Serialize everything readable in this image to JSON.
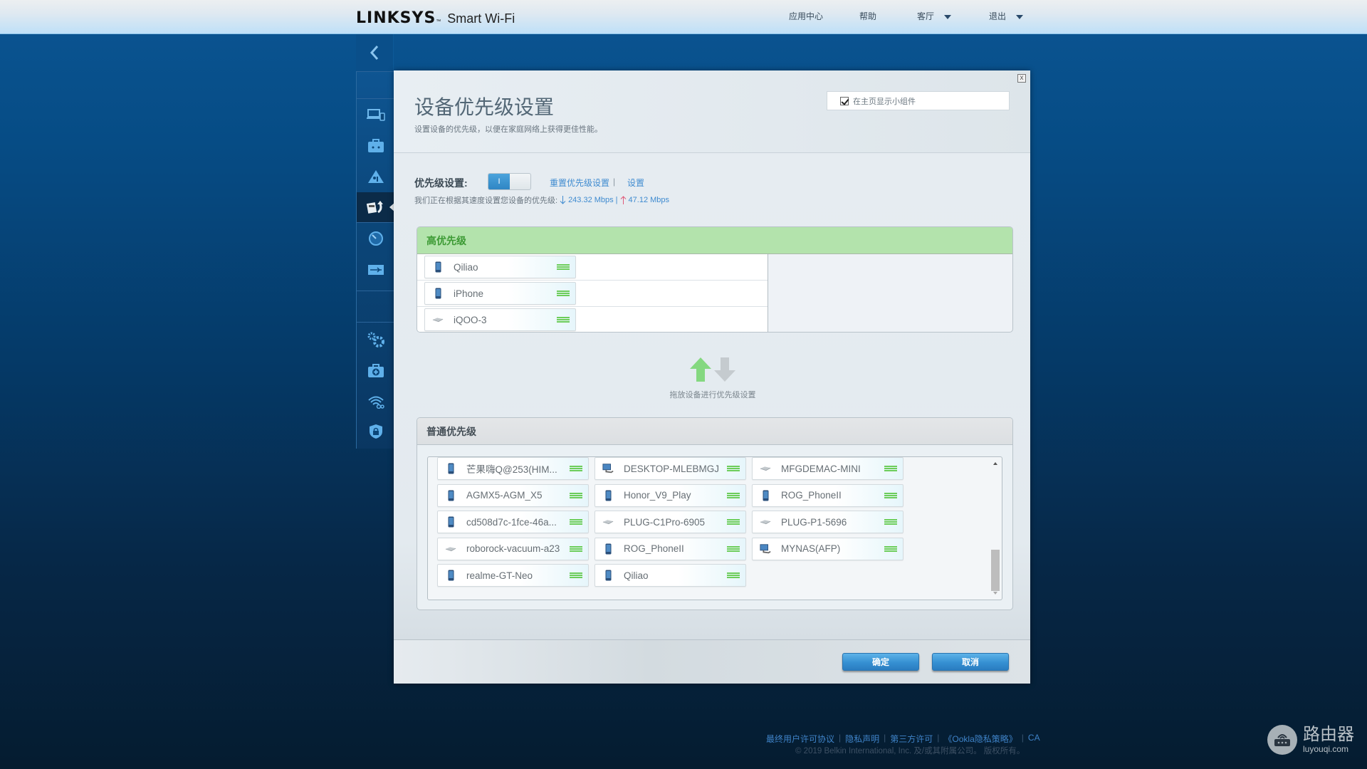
{
  "header": {
    "brand": "LINKSYS",
    "brand_tm": "™",
    "product": "Smart Wi-Fi",
    "nav": [
      {
        "label": "应用中心"
      },
      {
        "label": "帮助"
      },
      {
        "label": "客厅",
        "has_dropdown": true
      },
      {
        "label": "退出",
        "has_dropdown": true
      }
    ]
  },
  "sidebar": {
    "back_icon": "chevron-left-icon",
    "items": [
      {
        "icon": "devices-icon",
        "name": "设备列表"
      },
      {
        "icon": "guest-access-icon",
        "name": "访客访问"
      },
      {
        "icon": "parental-controls-icon",
        "name": "家长控制"
      },
      {
        "icon": "media-prioritization-icon",
        "name": "设备优先级",
        "active": true
      },
      {
        "icon": "speed-test-icon",
        "name": "速度测试"
      },
      {
        "icon": "external-storage-icon",
        "name": "外部存储"
      },
      {
        "icon": "connectivity-icon",
        "name": "连接"
      },
      {
        "icon": "troubleshooting-icon",
        "name": "故障排除"
      },
      {
        "icon": "wireless-icon",
        "name": "无线"
      },
      {
        "icon": "security-icon",
        "name": "安全"
      }
    ]
  },
  "dialog": {
    "close_label": "x",
    "title": "设备优先级设置",
    "subtitle": "设置设备的优先级，以便在家庭网络上获得更佳性能。",
    "show_widget": {
      "label": "在主页显示小组件",
      "checked": true
    },
    "priority_label": "优先级设置:",
    "toggle": {
      "state_label": "I",
      "on": true
    },
    "reset_link": "重置优先级设置",
    "separator": "|",
    "settings_link": "设置",
    "speed_text": "我们正在根据其速度设置您设备的优先级:",
    "download_speed": "243.32 Mbps",
    "speed_separator": "|",
    "upload_speed": "47.12 Mbps",
    "high_priority": {
      "title": "高优先级",
      "devices": [
        {
          "name": "Qiliao",
          "type": "phone"
        },
        {
          "name": "iPhone",
          "type": "phone"
        },
        {
          "name": "iQOO-3",
          "type": "generic"
        }
      ]
    },
    "drop_hint": "拖放设备进行优先级设置",
    "normal_priority": {
      "title": "普通优先级",
      "devices": [
        {
          "name": "芒果嗨Q@253(HIM...",
          "type": "phone"
        },
        {
          "name": "DESKTOP-MLEBMGJ",
          "type": "computer"
        },
        {
          "name": "MFGDEMAC-MINI",
          "type": "generic"
        },
        {
          "name": "AGMX5-AGM_X5",
          "type": "phone"
        },
        {
          "name": "Honor_V9_Play",
          "type": "phone"
        },
        {
          "name": "ROG_PhoneII",
          "type": "phone"
        },
        {
          "name": "cd508d7c-1fce-46a...",
          "type": "phone"
        },
        {
          "name": "PLUG-C1Pro-6905",
          "type": "generic"
        },
        {
          "name": "PLUG-P1-5696",
          "type": "generic"
        },
        {
          "name": "roborock-vacuum-a23",
          "type": "generic"
        },
        {
          "name": "ROG_PhoneII",
          "type": "phone"
        },
        {
          "name": "MYNAS(AFP)",
          "type": "computer"
        },
        {
          "name": "realme-GT-Neo",
          "type": "phone"
        },
        {
          "name": "Qiliao",
          "type": "phone"
        }
      ]
    },
    "ok_button": "确定",
    "cancel_button": "取消"
  },
  "footer": {
    "links": [
      "最终用户许可协议",
      "隐私声明",
      "第三方许可",
      "《Ookla隐私策略》",
      "CA"
    ],
    "link_separator": "|",
    "copyright": "© 2019 Belkin International, Inc. 及/或其附属公司。 版权所有。"
  },
  "watermark": {
    "title": "路由器",
    "domain": "luyouqi.com"
  },
  "colors": {
    "accent_blue": "#3f8bd0",
    "high_priority_header": "#b3e3ac",
    "high_priority_text": "#3c9a34",
    "drag_handle": "#6ccd5a",
    "upload_arrow": "#e05a7a"
  }
}
